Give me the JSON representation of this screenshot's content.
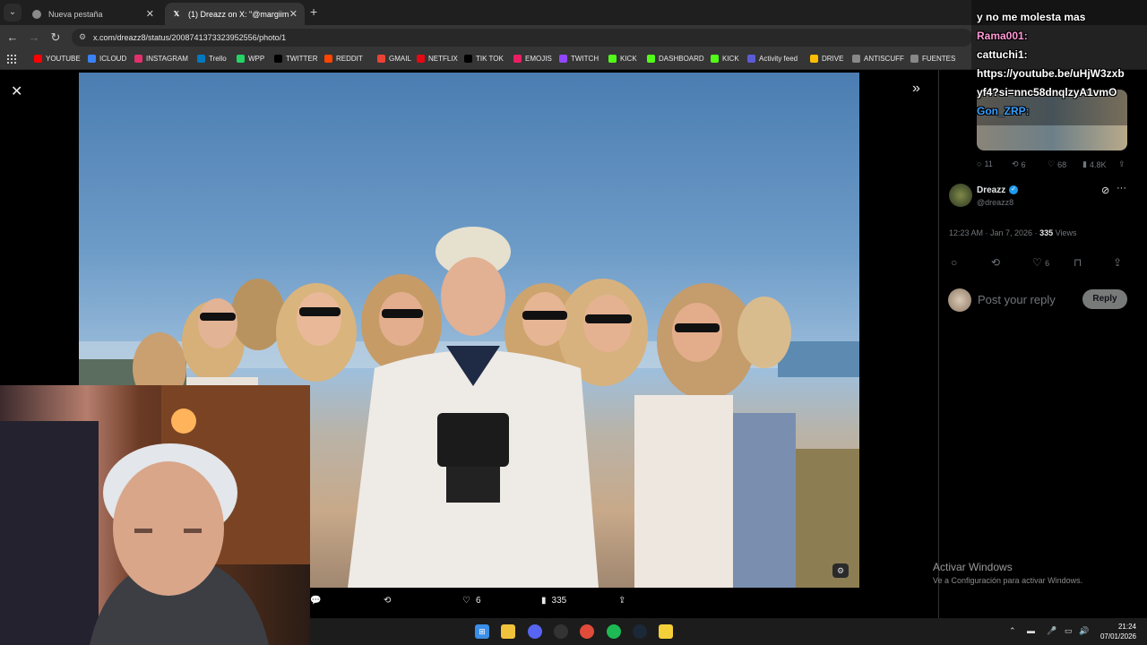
{
  "tabs": [
    {
      "title": "Nueva pestaña",
      "active": false
    },
    {
      "title": "(1) Dreazz on X: \"@margiim_h",
      "active": true
    }
  ],
  "address_bar": {
    "url": "x.com/dreazz8/status/2008741373323952556/photo/1"
  },
  "bookmarks": [
    {
      "label": "YOUTUBE",
      "icon": "youtube-icon",
      "color": "#ff0000"
    },
    {
      "label": "ICLOUD",
      "icon": "cloud-icon",
      "color": "#3b82f6"
    },
    {
      "label": "INSTAGRAM",
      "icon": "instagram-icon",
      "color": "#e1306c"
    },
    {
      "label": "Trello",
      "icon": "trello-icon",
      "color": "#0079bf"
    },
    {
      "label": "WPP",
      "icon": "whatsapp-icon",
      "color": "#25d366"
    },
    {
      "label": "TWITTER",
      "icon": "x-icon",
      "color": "#000000"
    },
    {
      "label": "REDDIT",
      "icon": "reddit-icon",
      "color": "#ff4500"
    },
    {
      "label": "GMAIL",
      "icon": "gmail-icon",
      "color": "#ea4335"
    },
    {
      "label": "NETFLIX",
      "icon": "netflix-icon",
      "color": "#e50914"
    },
    {
      "label": "TIK TOK",
      "icon": "tiktok-icon",
      "color": "#000000"
    },
    {
      "label": "EMOJIS",
      "icon": "emoji-icon",
      "color": "#e91e63"
    },
    {
      "label": "TWITCH",
      "icon": "twitch-icon",
      "color": "#9146ff"
    },
    {
      "label": "KICK",
      "icon": "kick-icon",
      "color": "#53fc18"
    },
    {
      "label": "DASHBOARD",
      "icon": "kick-icon",
      "color": "#53fc18"
    },
    {
      "label": "KICK",
      "icon": "kick-icon",
      "color": "#53fc18"
    },
    {
      "label": "Activity feed",
      "icon": "anchor-icon",
      "color": "#5b5bd6"
    },
    {
      "label": "DRIVE",
      "icon": "drive-icon",
      "color": "#fbbc04"
    },
    {
      "label": "ANTISCUFF",
      "icon": "antiscuff-icon",
      "color": "#888888"
    },
    {
      "label": "FUENTES",
      "icon": "globe-icon",
      "color": "#888888"
    }
  ],
  "photo_actions": {
    "like_count": "6",
    "views_count": "335"
  },
  "side_panel": {
    "prev_metrics": {
      "replies": "11",
      "reposts": "6",
      "likes": "68",
      "views": "4.8K"
    },
    "author": {
      "name": "Dreazz",
      "handle": "@dreazz8"
    },
    "timestamp": "12:23 AM · Jan 7, 2026 · ",
    "views": "335",
    "views_label": " Views",
    "likes": "6",
    "reply_placeholder": "Post your reply",
    "reply_button": "Reply"
  },
  "chat_overlay": {
    "line1": "y no me molesta mas",
    "user1": "Rama001:",
    "user2": "cattuchi1:",
    "link1": "https://youtube.be/uHjW3zxb",
    "link2": "yf4?si=nnc58dnqlzyA1vmO",
    "user3": "Gon_ZRP:"
  },
  "watermark": {
    "line1": "Activar Windows",
    "line2": "Ve a Configuración para activar Windows."
  },
  "taskbar": {
    "time": "21:24",
    "date": "07/01/2026"
  }
}
